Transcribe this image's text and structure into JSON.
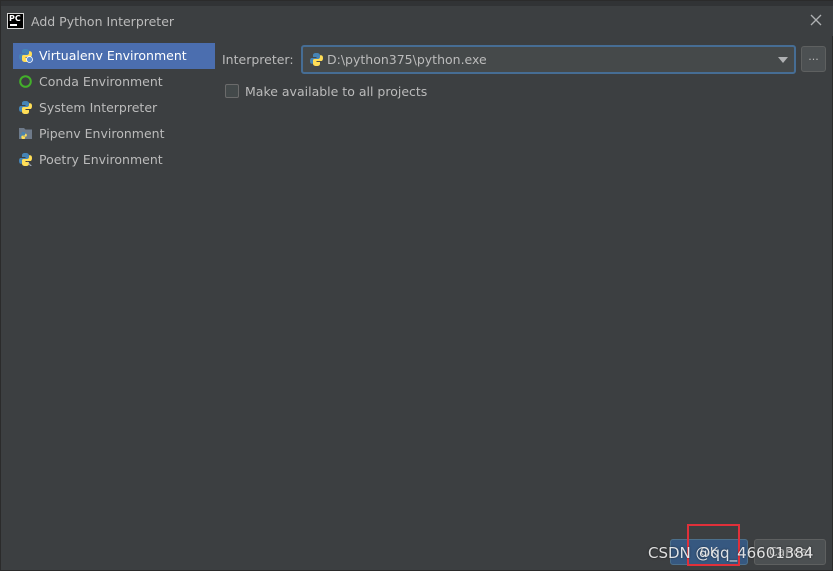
{
  "dialog": {
    "title": "Add Python Interpreter",
    "app_icon_text": "PC"
  },
  "sidebar": {
    "items": [
      {
        "label": "Virtualenv Environment",
        "icon": "python-virtualenv-icon",
        "selected": true
      },
      {
        "label": "Conda Environment",
        "icon": "conda-icon",
        "selected": false
      },
      {
        "label": "System Interpreter",
        "icon": "python-icon",
        "selected": false
      },
      {
        "label": "Pipenv Environment",
        "icon": "pipenv-icon",
        "selected": false
      },
      {
        "label": "Poetry Environment",
        "icon": "poetry-icon",
        "selected": false
      }
    ]
  },
  "content": {
    "interpreter_label": "Interpreter:",
    "interpreter_value": "D:\\python375\\python.exe",
    "browse_label": "...",
    "make_available_label": "Make available to all projects",
    "make_available_checked": false
  },
  "footer": {
    "ok_label": "OK",
    "cancel_label": "Cancel",
    "watermark": "CSDN @qq_46601384"
  },
  "colors": {
    "background": "#3c3f41",
    "selected": "#4b6eaf",
    "highlight": "#e0303a"
  }
}
